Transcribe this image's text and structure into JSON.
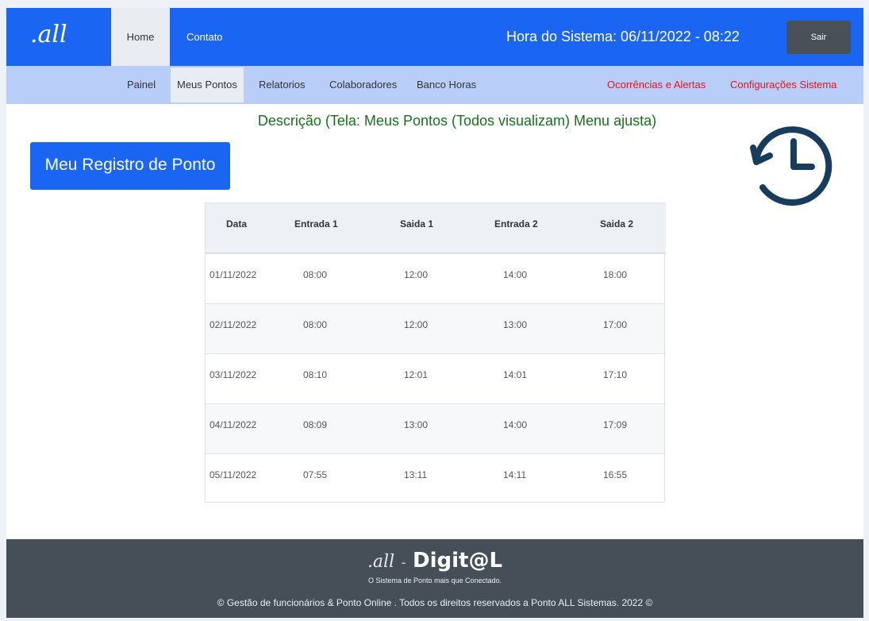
{
  "header": {
    "logo": ".all",
    "nav": {
      "home": "Home",
      "contato": "Contato"
    },
    "system_time_label": "Hora do Sistema: 06/11/2022 - 08:22",
    "logout": "Sair",
    "colors": {
      "primary": "#1a66f2",
      "logout_bg": "#4a5058"
    }
  },
  "subnav": {
    "items": [
      "Painel",
      "Meus Pontos",
      "Relatorios",
      "Colaboradores",
      "Banco Horas"
    ],
    "active": "Meus Pontos",
    "alerts": "Ocorrências e Alertas",
    "settings": "Configurações Sistema",
    "colors": {
      "background": "#b8cdf8",
      "alert_text": "#e8131a"
    }
  },
  "main": {
    "description": "Descrição (Tela: Meus Pontos (Todos visualizam) Menu ajusta)",
    "register_button": "Meu Registro de Ponto",
    "icon": "history-clock-icon"
  },
  "table": {
    "columns": [
      "Data",
      "Entrada 1",
      "Saida 1",
      "Entrada 2",
      "Saida 2"
    ],
    "rows": [
      [
        "01/11/2022",
        "08:00",
        "12:00",
        "14:00",
        "18:00"
      ],
      [
        "02/11/2022",
        "08:00",
        "12:00",
        "13:00",
        "17:00"
      ],
      [
        "03/11/2022",
        "08:10",
        "12:01",
        "14:01",
        "17:10"
      ],
      [
        "04/11/2022",
        "08:09",
        "13:00",
        "14:00",
        "17:09"
      ],
      [
        "05/11/2022",
        "07:55",
        "13:11",
        "14:11",
        "16:55"
      ]
    ]
  },
  "footer": {
    "logo_all": ".all",
    "logo_dash": "-",
    "logo_digital": "Digit@L",
    "tagline": "O Sistema de Ponto mais que Conectado.",
    "copyright": "© Gestão de funcionários & Ponto Online .  Todos os direitos reservados a Ponto ALL Sistemas.   2022 ©",
    "colors": {
      "background": "#464e58"
    }
  }
}
